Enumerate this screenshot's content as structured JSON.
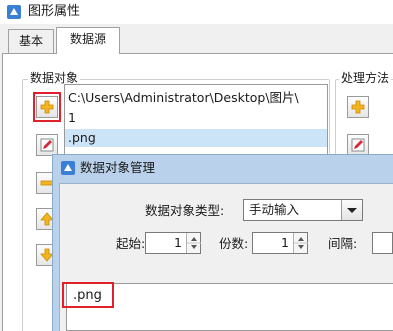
{
  "window": {
    "title": "图形属性"
  },
  "tabs": [
    {
      "label": "基本"
    },
    {
      "label": "数据源"
    }
  ],
  "left_group": {
    "label": "数据对象"
  },
  "right_group": {
    "label": "处理方法"
  },
  "list": {
    "items": [
      "C:\\Users\\Administrator\\Desktop\\图片\\",
      "1",
      ".png"
    ],
    "selected_index": 2
  },
  "dialog": {
    "title": "数据对象管理",
    "type_label": "数据对象类型:",
    "type_value": "手动输入",
    "start_label": "起始:",
    "start_value": "1",
    "count_label": "份数:",
    "count_value": "1",
    "interval_label": "间隔:",
    "text_value": ".png"
  },
  "colors": {
    "highlight": "#e0202a",
    "selection": "#cce4f7",
    "dialog_frame": "#b9d1ea"
  },
  "icons": {
    "add": "plus-icon",
    "edit": "pencil-icon",
    "remove": "minus-icon",
    "up": "arrow-up-icon",
    "down": "arrow-down-icon"
  }
}
